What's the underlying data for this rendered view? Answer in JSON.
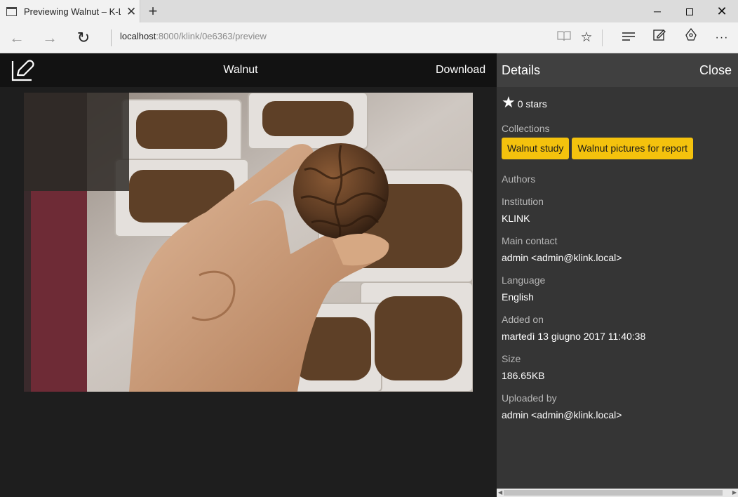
{
  "browser": {
    "tab_title": "Previewing Walnut – K-Link",
    "new_tab": "+",
    "window_controls": {
      "minimize": "─",
      "close": "✕"
    },
    "address": {
      "host": "localhost",
      "rest": ":8000/klink/0e6363/preview"
    },
    "icons": [
      "page-icon",
      "back-icon",
      "forward-icon",
      "refresh-icon",
      "reading-view-icon",
      "favorite-star-icon",
      "hub-icon",
      "web-note-icon",
      "share-icon",
      "more-icon"
    ]
  },
  "header": {
    "title": "Walnut",
    "download": "Download"
  },
  "preview": {
    "image_description": "hand holding a walnut over trays of walnuts"
  },
  "details": {
    "title": "Details",
    "close": "Close",
    "stars": "0 stars",
    "collections_label": "Collections",
    "collections": [
      "Walnut study",
      "Walnut pictures for report"
    ],
    "authors_label": "Authors",
    "institution_label": "Institution",
    "institution": "KLINK",
    "main_contact_label": "Main contact",
    "main_contact": "admin <admin@klink.local>",
    "language_label": "Language",
    "language": "English",
    "added_on_label": "Added on",
    "added_on": "martedì 13 giugno 2017 11:40:38",
    "size_label": "Size",
    "size": "186.65KB",
    "uploaded_by_label": "Uploaded by",
    "uploaded_by": "admin <admin@klink.local>"
  },
  "colors": {
    "chip": "#f4c20d",
    "panel": "#353535",
    "panel_header": "#404040",
    "app_header": "#121212"
  }
}
